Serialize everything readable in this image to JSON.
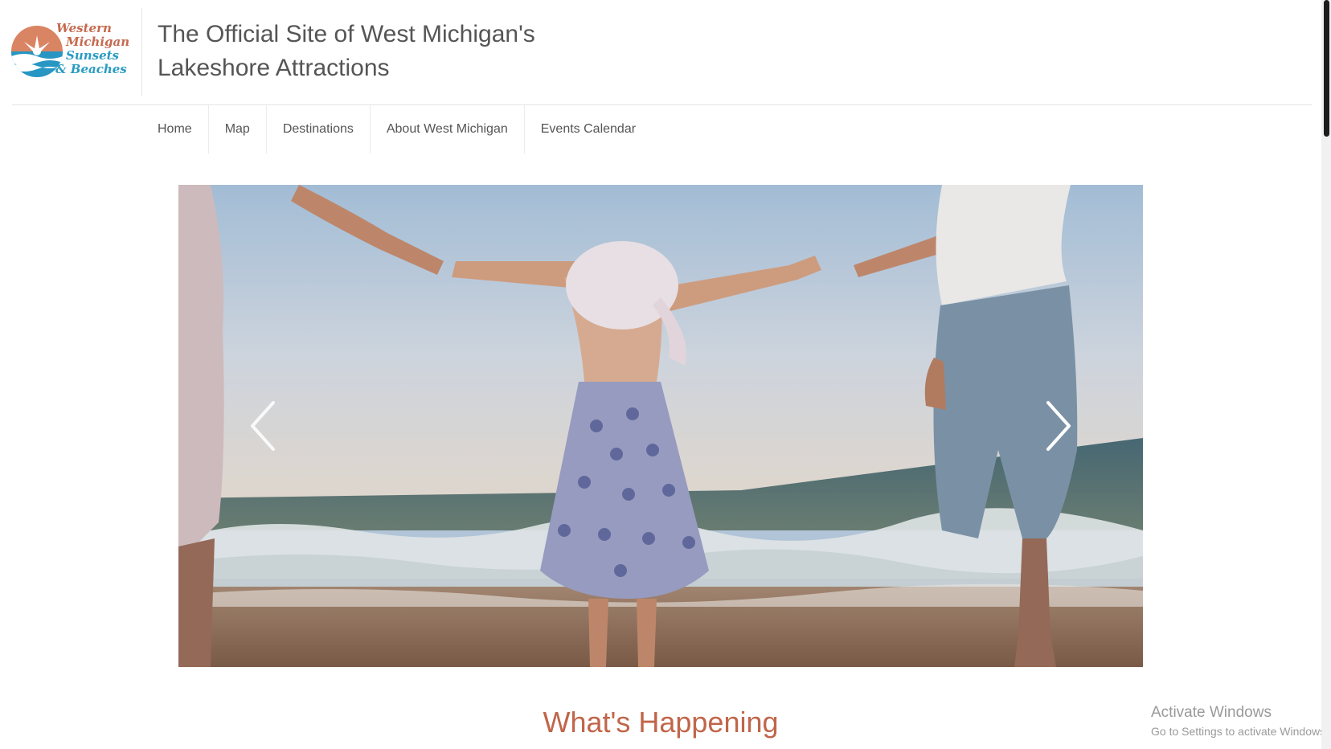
{
  "logo": {
    "lines": [
      "Western",
      "Michigan",
      "Sunsets",
      "& Beaches"
    ],
    "accent": "#c46a4f",
    "secondary": "#2a9bc2"
  },
  "site": {
    "title_line1": "The Official Site of West Michigan's",
    "title_line2": "Lakeshore Attractions"
  },
  "nav": {
    "items": [
      {
        "label": "Home"
      },
      {
        "label": "Map"
      },
      {
        "label": "Destinations"
      },
      {
        "label": "About West Michigan"
      },
      {
        "label": "Events Calendar"
      }
    ]
  },
  "carousel": {
    "prev_icon": "chevron-left-icon",
    "next_icon": "chevron-right-icon"
  },
  "section": {
    "heading": "What's Happening",
    "heading_color": "#c0664a"
  },
  "watermark": {
    "title": "Activate Windows",
    "subtitle": "Go to Settings to activate Windows."
  }
}
